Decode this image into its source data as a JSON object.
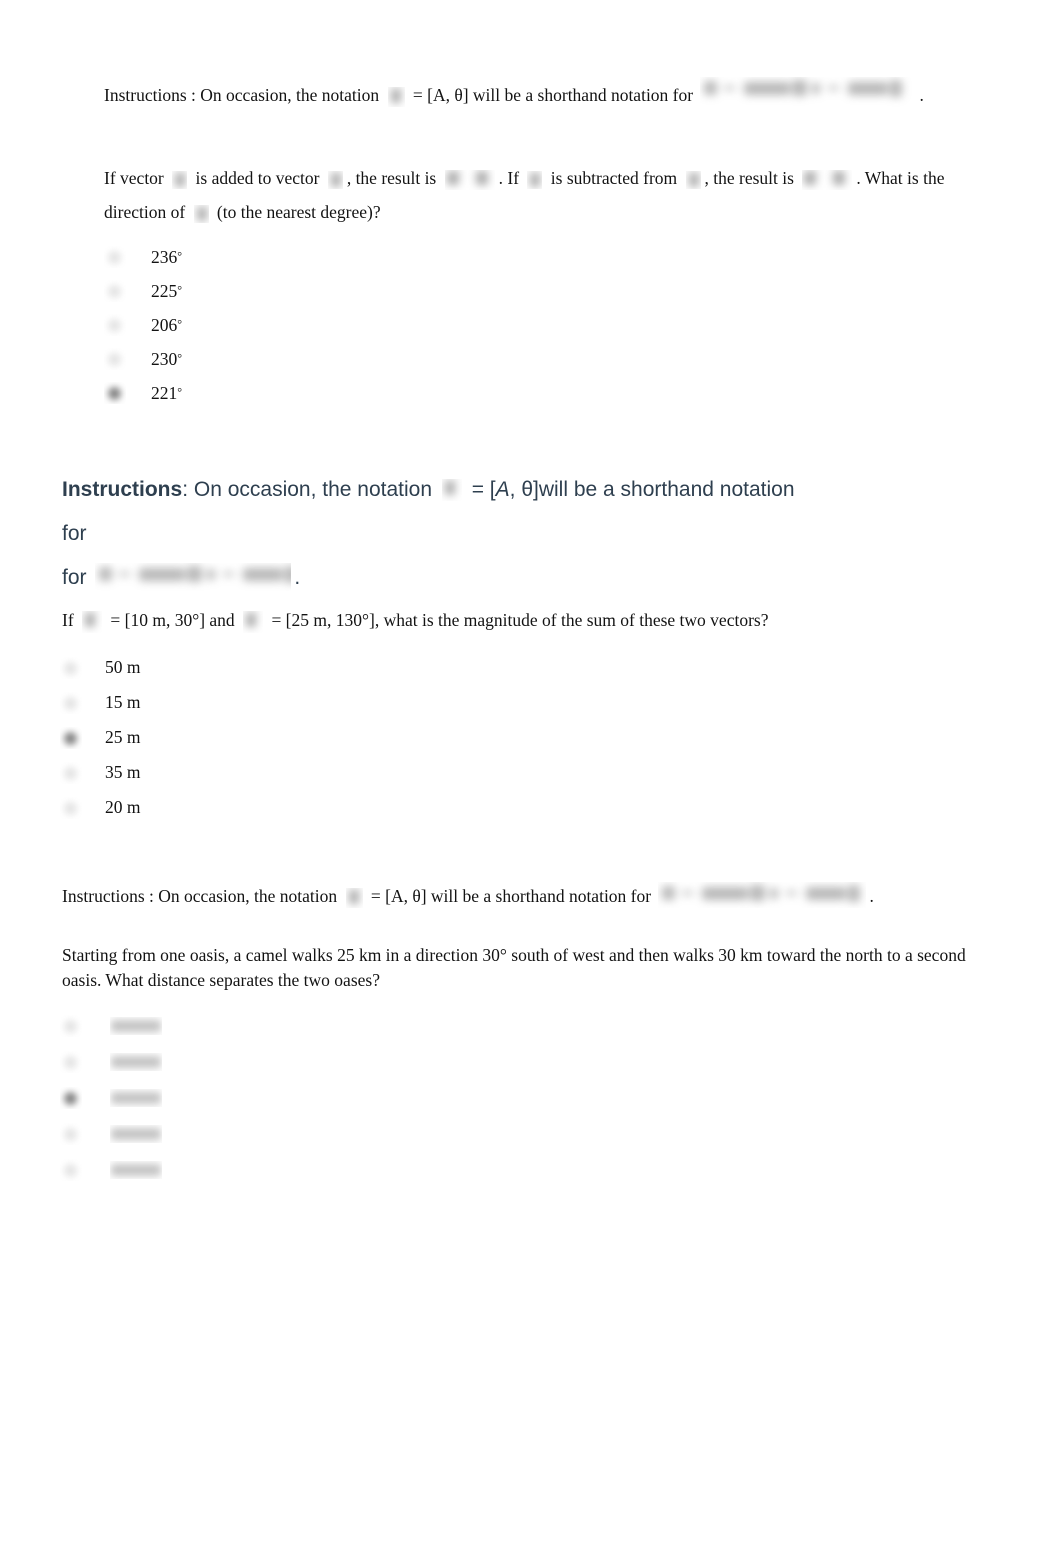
{
  "document": {
    "title": "Vector Addition Quiz",
    "background_color": "#ffffff",
    "serif_text_color": "#131313",
    "sans_text_color": "#2e3f4f"
  },
  "sections": [
    {
      "id": "q1",
      "instructions": {
        "label": "Instructions",
        "separator": " : ",
        "text_before_symbol": "On occasion, the notation ",
        "text_after_symbol": " = [A, θ] will be a shorthand notation for ",
        "trailing": ".",
        "symbol_alt": "vector-A",
        "formula_alt": "A = A cosθ i + A sinθ j"
      },
      "question": {
        "part1": "If vector ",
        "part2": " is added to vector ",
        "part3": ", the result is ",
        "part4": ". If ",
        "part5": " is subtracted from ",
        "part6": ", the result is ",
        "part7": ". What is the direction of ",
        "part8": " (to the nearest degree)?"
      },
      "options": [
        {
          "label": "236",
          "unit": "°",
          "selected": false
        },
        {
          "label": "225",
          "unit": "°",
          "selected": false
        },
        {
          "label": "206",
          "unit": "°",
          "selected": false
        },
        {
          "label": "230",
          "unit": "°",
          "selected": false
        },
        {
          "label": "221",
          "unit": "°",
          "selected": true
        }
      ]
    },
    {
      "id": "q2",
      "instructions": {
        "label": "Instructions",
        "separator": ": ",
        "text_before_symbol": "On occasion, the notation ",
        "text_mid": " = [",
        "italic_a": "A",
        "comma": ", ",
        "theta": "θ",
        "text_after_symbol": "]will be a shorthand notation for ",
        "for_word": "for ",
        "trailing": "."
      },
      "question": {
        "part1": "If ",
        "part2": " = [10 m, 30°] and ",
        "part3": " = [25 m, 130°], what is the magnitude of the sum of these two vectors?"
      },
      "options": [
        {
          "label": "50 m",
          "selected": false
        },
        {
          "label": "15 m",
          "selected": false
        },
        {
          "label": "25 m",
          "selected": true
        },
        {
          "label": "35 m",
          "selected": false
        },
        {
          "label": "20 m",
          "selected": false
        }
      ]
    },
    {
      "id": "q3",
      "instructions": {
        "label": "Instructions",
        "separator": " : ",
        "text_before_symbol": "On occasion, the notation ",
        "text_after_symbol": " = [A, θ] will be a shorthand notation for ",
        "trailing": "."
      },
      "question": {
        "line1": "Starting from one oasis, a camel walks 25 km in a direction 30° south of west and then walks 30 km toward the north to a",
        "line2": "second oasis. What distance separates the two oases?"
      },
      "options": [
        {
          "label": "",
          "blurred": true,
          "selected": false
        },
        {
          "label": "",
          "blurred": true,
          "selected": false
        },
        {
          "label": "",
          "blurred": true,
          "selected": true
        },
        {
          "label": "",
          "blurred": true,
          "selected": false
        },
        {
          "label": "",
          "blurred": true,
          "selected": false
        }
      ]
    }
  ]
}
